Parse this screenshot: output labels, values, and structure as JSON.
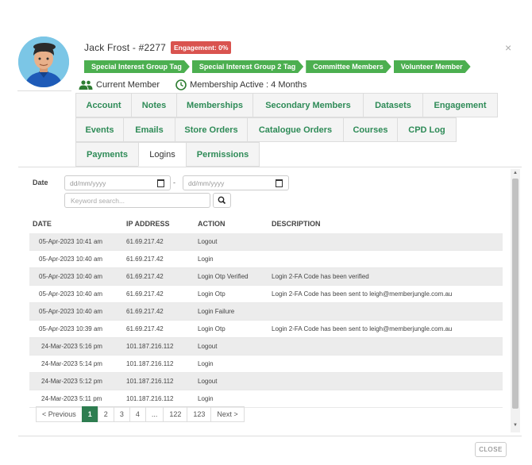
{
  "member": {
    "name": "Jack Frost - #2277",
    "engagement_badge": "Engagement: 0%"
  },
  "tags": [
    "Special Interest Group Tag",
    "Special Interest Group 2 Tag",
    "Committee Members",
    "Volunteer Member"
  ],
  "status": {
    "member_status": "Current Member",
    "membership": "Membership Active : 4 Months"
  },
  "tabs": {
    "row1": [
      "Account",
      "Notes",
      "Memberships",
      "Secondary Members",
      "Datasets",
      "Engagement"
    ],
    "row2": [
      "Events",
      "Emails",
      "Store Orders",
      "Catalogue Orders",
      "Courses",
      "CPD Log"
    ],
    "row3": [
      "Payments",
      "Logins",
      "Permissions"
    ],
    "active": "Logins"
  },
  "filters": {
    "date_label": "Date",
    "date_from_placeholder": "dd/mm/yyyy",
    "date_separator": "-",
    "date_to_placeholder": "dd/mm/yyyy",
    "search_placeholder": "Keyword search..."
  },
  "table": {
    "columns": [
      "DATE",
      "IP ADDRESS",
      "ACTION",
      "DESCRIPTION"
    ],
    "rows": [
      [
        "05-Apr-2023 10:41 am",
        "61.69.217.42",
        "Logout",
        ""
      ],
      [
        "05-Apr-2023 10:40 am",
        "61.69.217.42",
        "Login",
        ""
      ],
      [
        "05-Apr-2023 10:40 am",
        "61.69.217.42",
        "Login Otp Verified",
        "Login 2-FA Code has been verified"
      ],
      [
        "05-Apr-2023 10:40 am",
        "61.69.217.42",
        "Login Otp",
        "Login 2-FA Code has been sent to leigh@memberjungle.com.au"
      ],
      [
        "05-Apr-2023 10:40 am",
        "61.69.217.42",
        "Login Failure",
        ""
      ],
      [
        "05-Apr-2023 10:39 am",
        "61.69.217.42",
        "Login Otp",
        "Login 2-FA Code has been sent to leigh@memberjungle.com.au"
      ],
      [
        "24-Mar-2023 5:16 pm",
        "101.187.216.112",
        "Logout",
        ""
      ],
      [
        "24-Mar-2023 5:14 pm",
        "101.187.216.112",
        "Login",
        ""
      ],
      [
        "24-Mar-2023 5:12 pm",
        "101.187.216.112",
        "Logout",
        ""
      ],
      [
        "24-Mar-2023 5:11 pm",
        "101.187.216.112",
        "Login",
        ""
      ]
    ]
  },
  "pagination": {
    "prev": "< Previous",
    "pages": [
      "1",
      "2",
      "3",
      "4",
      "...",
      "122",
      "123"
    ],
    "current": "1",
    "next": "Next >"
  },
  "footer": {
    "close_label": "CLOSE",
    "close_x": "×"
  },
  "colors": {
    "brand_green": "#4caf50",
    "tab_text_green": "#2e8b57",
    "pager_active": "#2e7d50",
    "badge_red": "#d9534f"
  }
}
